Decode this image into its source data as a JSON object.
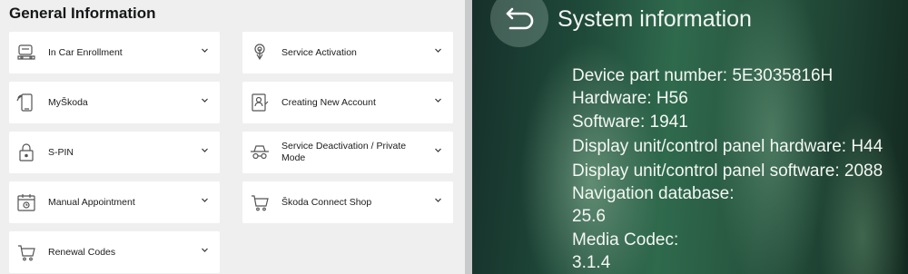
{
  "left": {
    "title": "General Information",
    "items": [
      {
        "label": "In Car Enrollment",
        "icon": "car-icon"
      },
      {
        "label": "Service Activation",
        "icon": "touch-icon"
      },
      {
        "label": "MyŠkoda",
        "icon": "phone-icon"
      },
      {
        "label": "Creating New Account",
        "icon": "account-icon"
      },
      {
        "label": "S-PIN",
        "icon": "lock-icon"
      },
      {
        "label": "Service Deactivation / Private Mode",
        "icon": "incognito-icon"
      },
      {
        "label": "Manual Appointment",
        "icon": "calendar-icon"
      },
      {
        "label": "Škoda Connect Shop",
        "icon": "cart-icon"
      },
      {
        "label": "Renewal Codes",
        "icon": "cart-icon"
      }
    ]
  },
  "right": {
    "title": "System information",
    "lines": [
      "Device part number: 5E3035816H",
      "Hardware: H56",
      "Software: 1941",
      "Display unit/control panel hardware: H44",
      "Display unit/control panel software: 2088",
      "Navigation database:",
      "25.6",
      "Media Codec:",
      "3.1.4"
    ]
  }
}
